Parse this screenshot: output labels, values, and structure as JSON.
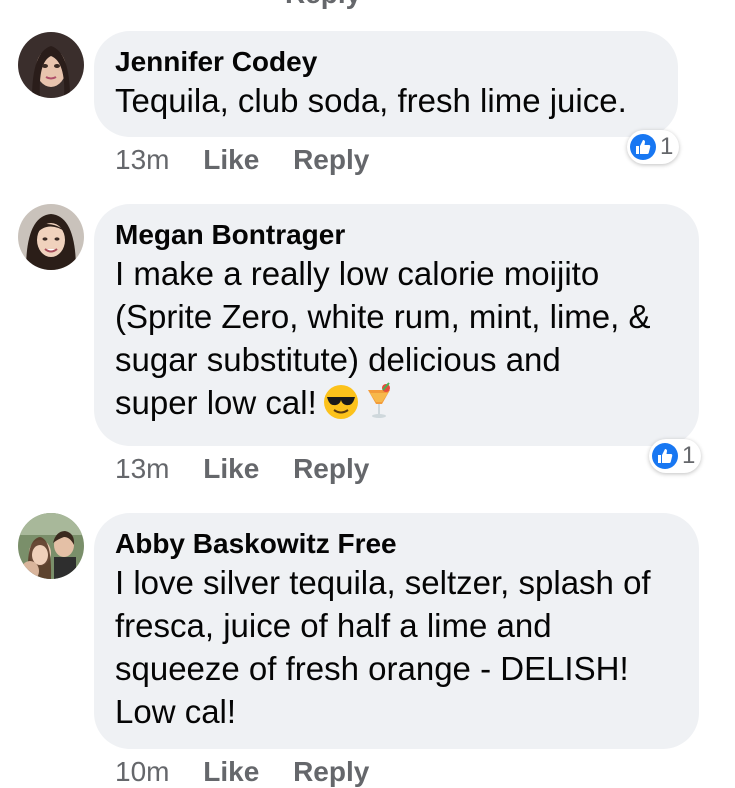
{
  "top_partial": "Reply",
  "comments": [
    {
      "author": "Jennifer Codey",
      "text": "Tequila, club soda, fresh lime juice.",
      "time": "13m",
      "like_label": "Like",
      "reply_label": "Reply",
      "reaction_count": "1"
    },
    {
      "author": "Megan Bontrager",
      "text_lines": [
        "I make a really low calorie moijito",
        "(Sprite Zero, white rum, mint, lime, &",
        "sugar substitute) delicious and",
        "super low cal!"
      ],
      "emojis": [
        "smiling-face-with-sunglasses-icon",
        "tropical-drink-icon"
      ],
      "time": "13m",
      "like_label": "Like",
      "reply_label": "Reply",
      "reaction_count": "1"
    },
    {
      "author": "Abby Baskowitz Free",
      "text_lines": [
        "I love silver tequila, seltzer, splash of",
        "fresca, juice of half a lime and",
        "squeeze of fresh orange - DELISH!",
        "Low cal!"
      ],
      "time": "10m",
      "like_label": "Like",
      "reply_label": "Reply"
    }
  ],
  "colors": {
    "bubble": "#eff1f4",
    "meta": "#65676b",
    "like_blue": "#1877f2"
  }
}
